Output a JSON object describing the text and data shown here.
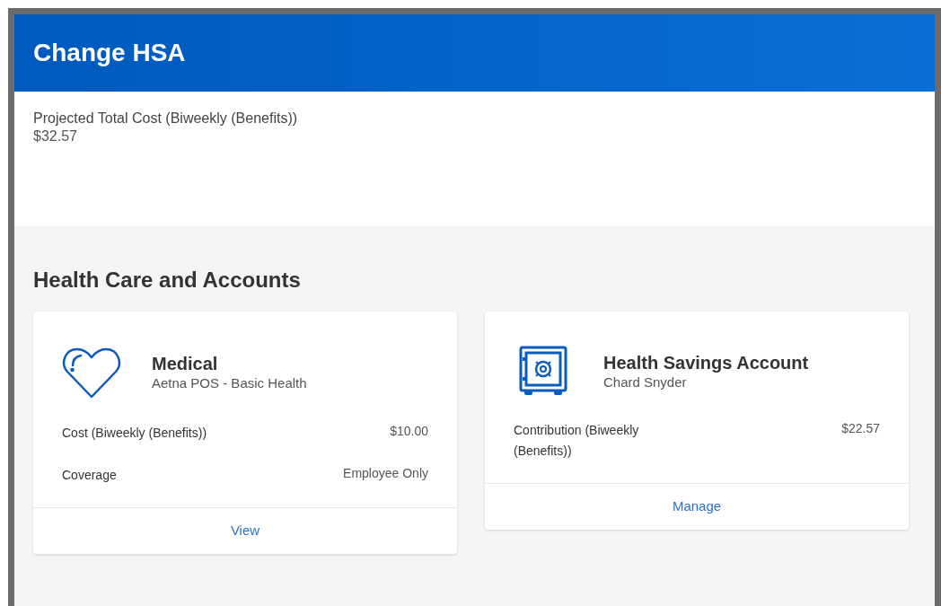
{
  "header": {
    "title": "Change HSA"
  },
  "summary": {
    "label": "Projected Total Cost (Biweekly (Benefits))",
    "value": "$32.57"
  },
  "section": {
    "title": "Health Care and Accounts"
  },
  "cards": [
    {
      "kind": "heart",
      "title": "Medical",
      "subtitle": "Aetna POS - Basic Health",
      "rows": [
        {
          "label": "Cost (Biweekly (Benefits))",
          "value": "$10.00"
        },
        {
          "label": "Coverage",
          "value": "Employee Only"
        }
      ],
      "action": "View"
    },
    {
      "kind": "safe",
      "title": "Health Savings Account",
      "subtitle": "Chard Snyder",
      "rows": [
        {
          "label": "Contribution (Biweekly (Benefits))",
          "value": "$22.57"
        }
      ],
      "action": "Manage"
    }
  ]
}
